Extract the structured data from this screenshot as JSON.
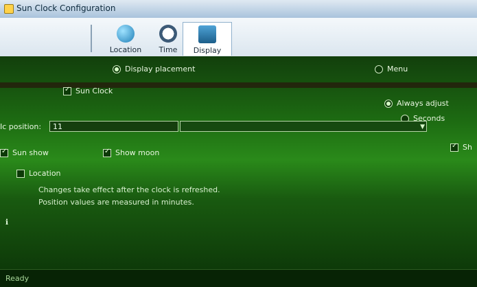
{
  "window": {
    "title": "Sun Clock Configuration",
    "app_icon": "sun-clock-icon"
  },
  "ribbon": {
    "tabs": [
      {
        "label": "Location",
        "icon": "globe-icon"
      },
      {
        "label": "Time",
        "icon": "clock-icon"
      },
      {
        "label": "Display",
        "icon": "monitor-icon"
      }
    ]
  },
  "display": {
    "placement_label": "Display placement",
    "menu_label": "Menu",
    "sun_clock_label": "Sun Clock",
    "always_adjust_label": "Always adjust",
    "seconds_label": "Seconds",
    "position_label": "Ic position:",
    "position_value": "11",
    "sun_show_label": "Sun show",
    "show_moon_label": "Show moon",
    "sh_label": "Sh",
    "local_label": "Location",
    "notes": [
      "Changes take effect after the clock is refreshed.",
      "Position values are measured in minutes."
    ]
  },
  "status": {
    "text": "Ready"
  },
  "colors": {
    "accent": "#2a8a1a",
    "title_bar": "#dfe9f2"
  }
}
